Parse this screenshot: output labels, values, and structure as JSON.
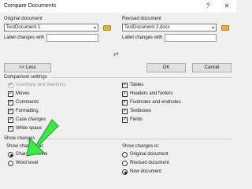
{
  "window": {
    "title": "Compare Documents",
    "help_label": "?",
    "close_label": "✕"
  },
  "original": {
    "heading": "Original document",
    "value": "TestDocument 1",
    "label_changes_with": "Label changes with"
  },
  "revised": {
    "heading": "Revised document",
    "value": "TestDocument 2.docx",
    "label_changes_with": "Label changes with"
  },
  "swap_symbol": "⇄",
  "buttons": {
    "less": "<< Less",
    "ok": "OK",
    "cancel": "Cancel"
  },
  "comparison_settings": {
    "heading": "Comparison settings",
    "left": [
      {
        "label": "Insertions and deletions",
        "checked": true,
        "disabled": true
      },
      {
        "label": "Moves",
        "checked": true
      },
      {
        "label": "Comments",
        "checked": true
      },
      {
        "label": "Formatting",
        "checked": true
      },
      {
        "label": "Case changes",
        "checked": true
      },
      {
        "label": "White space",
        "checked": true
      }
    ],
    "right": [
      {
        "label": "Tables",
        "checked": true
      },
      {
        "label": "Headers and footers",
        "checked": true
      },
      {
        "label": "Footnotes and endnotes",
        "checked": true
      },
      {
        "label": "Textboxes",
        "checked": true
      },
      {
        "label": "Fields",
        "checked": true
      }
    ]
  },
  "show_changes": {
    "heading": "Show changes",
    "at_label": "Show changes at:",
    "at_options": [
      {
        "label": "Character level",
        "selected": true
      },
      {
        "label": "Word level",
        "selected": false
      }
    ],
    "in_label": "Show changes in:",
    "in_options": [
      {
        "label": "Original document",
        "selected": false
      },
      {
        "label": "Revised document",
        "selected": false
      },
      {
        "label": "New document",
        "selected": true
      }
    ]
  },
  "colors": {
    "arrow": "#3ee84a",
    "arrow_outline": "#2aa833",
    "background": "#f0f0f0",
    "folder": "#e0b13d"
  }
}
